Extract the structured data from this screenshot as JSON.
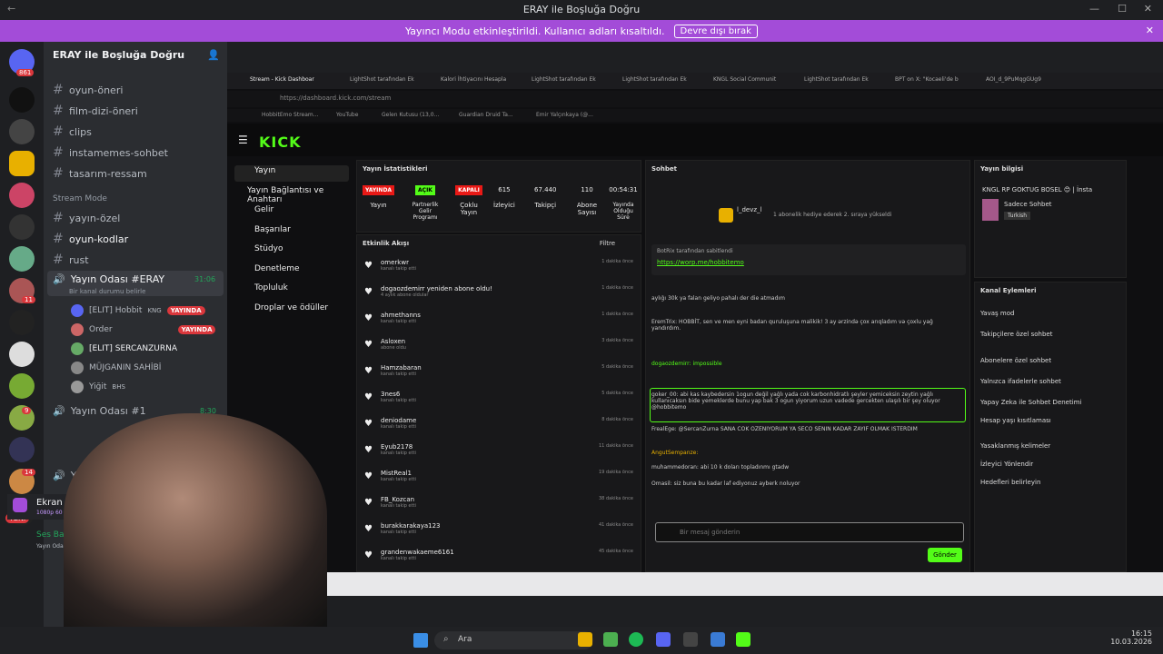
{
  "window": {
    "title": "ERAY ile Boşluğa Doğru"
  },
  "banner": {
    "text": "Yayıncı Modu etkinleştirildi. Kullanıcı adları kısaltıldı.",
    "button": "Devre dışı bırak"
  },
  "servers": {
    "home_badge": "861",
    "badges": [
      "11",
      "9",
      "14",
      "172"
    ],
    "new_label": "YENİ"
  },
  "sidebar": {
    "server_name": "ERAY ile Boşluğa Doğru",
    "channels": [
      {
        "label": "oyun-öneri"
      },
      {
        "label": "film-dizi-öneri"
      },
      {
        "label": "clips"
      },
      {
        "label": "instamemes-sohbet"
      },
      {
        "label": "tasarım-ressam"
      }
    ],
    "category": "Stream Mode",
    "channels2": [
      {
        "label": "yayın-özel"
      },
      {
        "label": "oyun-kodlar"
      },
      {
        "label": "rust"
      }
    ],
    "voice1": {
      "name": "Yayın Odası #ERAY",
      "time": "31:06",
      "status": "Bir kanal durumu belirle"
    },
    "voice_users": [
      {
        "name": "[ELIT] Hobbit",
        "extra": "KNG",
        "live": "YAYINDA"
      },
      {
        "name": "Order",
        "extra": "",
        "live": "YAYINDA"
      },
      {
        "name": "[ELIT] SERCANZURNA",
        "extra": "",
        "live": ""
      },
      {
        "name": "MÜJGANIN SAHİBİ",
        "extra": "",
        "live": ""
      },
      {
        "name": "Yiğit",
        "extra": "BHS",
        "live": ""
      }
    ],
    "voice2": {
      "name": "Yayın Odası #1",
      "time": "8:30"
    },
    "voice3": {
      "name": "Yayın"
    },
    "screen": {
      "title": "Ekran 1",
      "sub": "1080p 60 FPS"
    },
    "connection": {
      "title": "Ses Bağlantısı",
      "sub": "Yayın Odası #EF"
    }
  },
  "browser": {
    "tabs": [
      "Stream - Kick Dashboar",
      "LightShot tarafından Ek",
      "Kalori İhtiyacını Hesapla",
      "LightShot tarafından Ek",
      "LightShot tarafından Ek",
      "KNGL Social Communit",
      "LightShot tarafından Ek",
      "BPT on X: \"Kocaeli'de b",
      "AOI_d_9PuMqgGUg9"
    ],
    "url": "https://dashboard.kick.com/stream",
    "bookmarks": [
      "HobbitEmo Stream...",
      "YouTube",
      "Gelen Kutusu (13,0...",
      "Guardian Druid Ta...",
      "Emir Yalçınkaya (@..."
    ]
  },
  "kick": {
    "logo": "KICK",
    "nav": [
      "Yayın",
      "Yayın Bağlantısı ve Anahtarı",
      "Gelir",
      "Başarılar",
      "Stüdyo",
      "Denetleme",
      "Topluluk",
      "Droplar ve ödüller"
    ],
    "stats_title": "Yayın İstatistikleri",
    "stats": [
      {
        "value": "YAYINDA",
        "label": "Yayın",
        "color": "#e91916"
      },
      {
        "value": "AÇIK",
        "label": "Partnerlik Gelir Programı",
        "color": "#53fc18"
      },
      {
        "value": "KAPALI",
        "label": "Çoklu Yayın",
        "color": "#e91916"
      },
      {
        "value": "615",
        "label": "İzleyici"
      },
      {
        "value": "67.440",
        "label": "Takipçi"
      },
      {
        "value": "110",
        "label": "Abone Sayısı"
      },
      {
        "value": "00:54:31",
        "label": "Yayında Olduğu Süre"
      }
    ],
    "activity_title": "Etkinlik Akışı",
    "activity_filter": "Filtre",
    "activity": [
      {
        "name": "omerkwr",
        "sub": "kanalı takip etti",
        "time": "1 dakika önce"
      },
      {
        "name": "dogaozdemirr yeniden abone oldu!",
        "sub": "4 aylık abone oldular",
        "time": "1 dakika önce"
      },
      {
        "name": "ahmethanns",
        "sub": "kanalı takip etti",
        "time": "1 dakika önce"
      },
      {
        "name": "Asloxen",
        "sub": "abone oldu",
        "time": "3 dakika önce"
      },
      {
        "name": "Hamzabaran",
        "sub": "kanalı takip etti",
        "time": "5 dakika önce"
      },
      {
        "name": "3nes6",
        "sub": "kanalı takip etti",
        "time": "5 dakika önce"
      },
      {
        "name": "deniodame",
        "sub": "kanalı takip etti",
        "time": "8 dakika önce"
      },
      {
        "name": "Eyub2178",
        "sub": "kanalı takip etti",
        "time": "11 dakika önce"
      },
      {
        "name": "MistReal1",
        "sub": "kanalı takip etti",
        "time": "19 dakika önce"
      },
      {
        "name": "FB_Kozcan",
        "sub": "kanalı takip etti",
        "time": "38 dakika önce"
      },
      {
        "name": "burakkarakaya123",
        "sub": "kanalı takip etti",
        "time": "41 dakika önce"
      },
      {
        "name": "grandenwakaeme6161",
        "sub": "kanalı takip etti",
        "time": "45 dakika önce"
      }
    ],
    "chat_title": "Sohbet",
    "chat_top_user": "l_devz_l",
    "chat_gift": "1 abonelik hediye ederek 2. sıraya yükseldi",
    "pinned_by": "BotRix tarafından sabitlendi",
    "pinned_link": "https://worp.me/hobbitemo",
    "messages": [
      "aylığı 30k ya falan geliyo pahalı der die atmadım",
      "EremTrix: HOBBİT, sen ve men eyni badan quruluşuna malikik! 3 ay ərzində çox arıqladım və çoxlu yağ yandırdım.",
      "dogaozdemirr: impossible",
      "goker_00: abi kas kaybedersin 1ogun değil yağlı yada cok karbonhidratlı şeyler yemiceksin zeytin yağlı kullanıcaksın bide yemeklerde bunu yap bak 3 ogun yiyorum uzun vadede gercekten ulaşılı bir şey oluyor @hobbitemo",
      "FrealEge: @SercanZurna SANA COK OZENIYORUM YA SECO SENIN KADAR ZAYIF OLMAK ISTERDIM",
      "AngutSempanze:",
      "muhammedoran: abi 10 k doları topladınmı gtadw",
      "Omasil: siz buna bu kadar laf ediyonuz ayberk noluyor"
    ],
    "chat_placeholder": "Bir mesaj gönderin",
    "send": "Gönder",
    "info_title": "Yayın bilgisi",
    "stream_title": "KNGL RP GOKTUG BOSEL 😊 | İnsta",
    "category": "Sadece Sohbet",
    "language": "Turkish",
    "actions_title": "Kanal Eylemleri",
    "actions": [
      "Yavaş mod",
      "Takipçilere özel sohbet",
      "Abonelere özel sohbet",
      "Yalnızca ifadelerle sohbet",
      "Yapay Zeka ile Sohbet Denetimi",
      "Hesap yaşı kısıtlaması",
      "Yasaklanmış kelimeler",
      "İzleyici Yönlendir",
      "Hedefleri belirleyin"
    ]
  },
  "taskbar": {
    "search": "Ara",
    "time": "16:15",
    "date": "10.03.2026"
  }
}
